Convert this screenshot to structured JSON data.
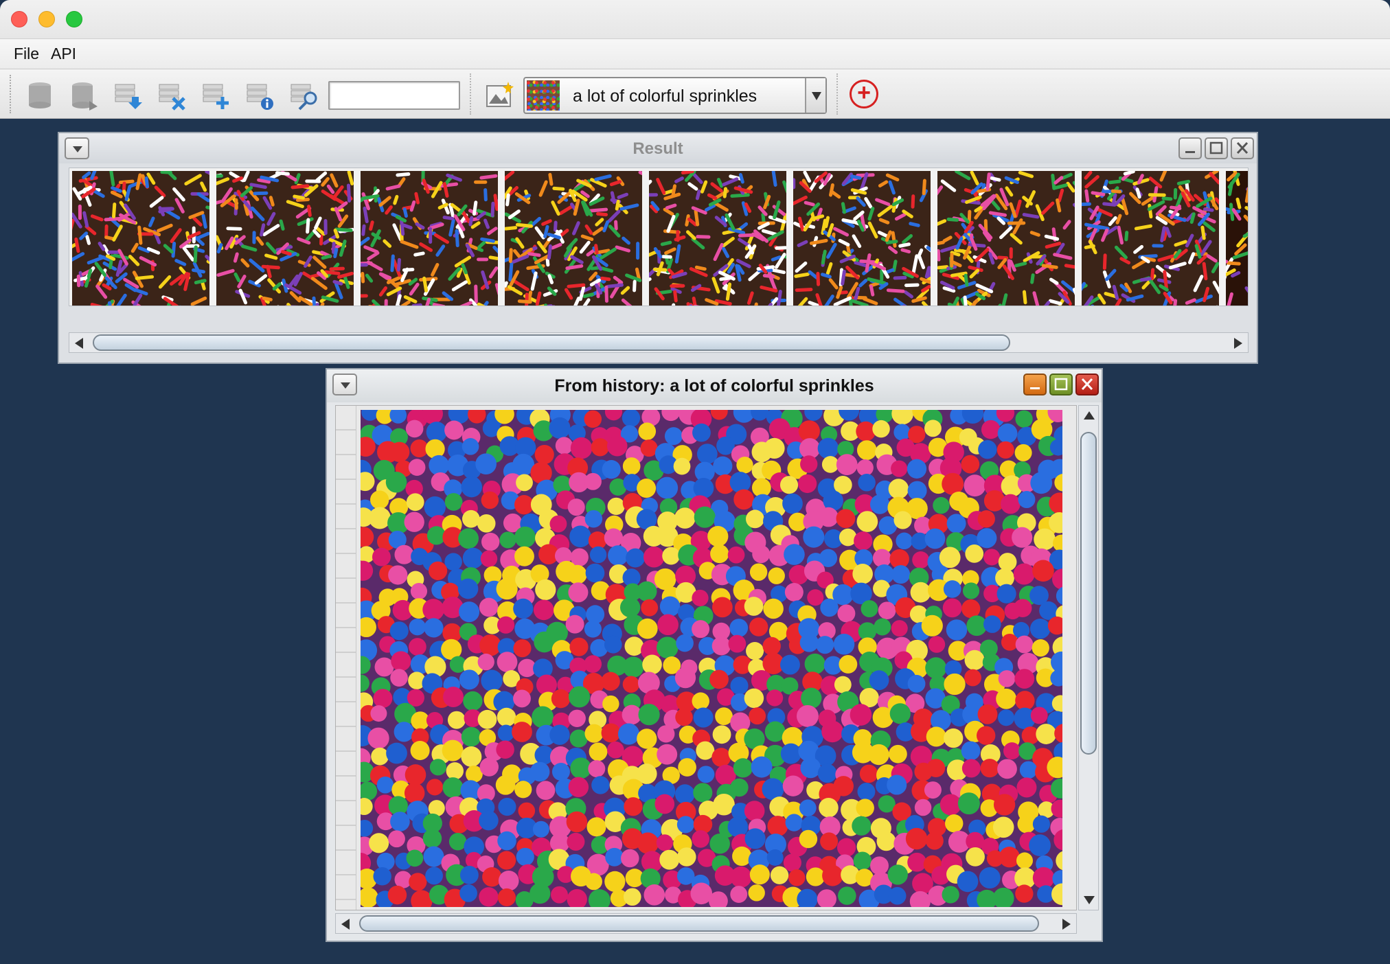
{
  "menubar": {
    "file": "File",
    "api": "API"
  },
  "toolbar": {
    "search_value": "",
    "combo_selected": "a lot of colorful sprinkles",
    "add_label": "+"
  },
  "result_frame": {
    "title": "Result",
    "thumbnail_count": 9
  },
  "history_frame": {
    "title": "From history: a lot of colorful sprinkles"
  },
  "colors": {
    "add_button": "#d62020",
    "desktop": "#1f3550"
  }
}
